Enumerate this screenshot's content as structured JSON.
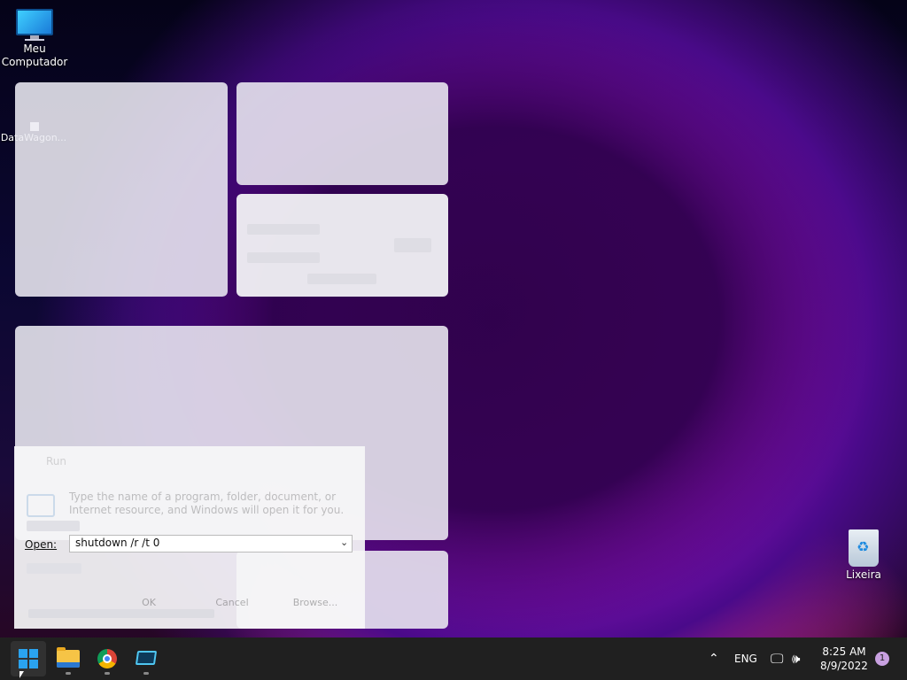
{
  "desktop": {
    "icons": [
      {
        "label": "Meu\nComputador",
        "icon": "monitor-icon"
      },
      {
        "label": "DataWagon...",
        "icon": "app-shortcut-icon"
      },
      {
        "label": "Lixeira",
        "icon": "recycle-bin-icon"
      }
    ]
  },
  "run_dialog": {
    "title": "Run",
    "description": "Type the name of a program, folder, document, or Internet resource, and Windows will open it for you.",
    "open_label": "Open:",
    "command_value": "shutdown /r /t 0",
    "ok_label": "OK",
    "cancel_label": "Cancel",
    "browse_label": "Browse..."
  },
  "taskbar": {
    "apps": [
      {
        "name": "start",
        "icon": "windows-start-icon"
      },
      {
        "name": "file-explorer",
        "icon": "folder-icon"
      },
      {
        "name": "chrome",
        "icon": "chrome-icon"
      },
      {
        "name": "remote-desktop",
        "icon": "remote-desktop-icon"
      }
    ],
    "tray": {
      "language": "ENG",
      "time": "8:25 AM",
      "date": "8/9/2022",
      "notification_count": "1"
    }
  },
  "colors": {
    "taskbar_bg": "#202020",
    "start_accent": "#2aa3ef"
  }
}
